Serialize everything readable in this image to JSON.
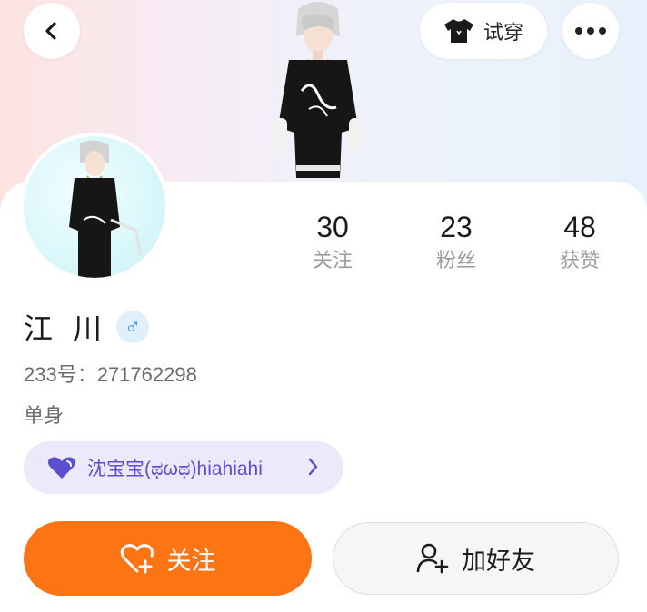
{
  "header": {
    "tryon_label": "试穿"
  },
  "stats": [
    {
      "value": "30",
      "label": "关注"
    },
    {
      "value": "23",
      "label": "粉丝"
    },
    {
      "value": "48",
      "label": "获赞"
    }
  ],
  "profile": {
    "name": "江川",
    "gender_symbol": "♂",
    "id_text": "233号：271762298",
    "relationship_status": "单身",
    "partner_label": "沈宝宝(ಥωಥ)hiahiahi"
  },
  "actions": {
    "follow_label": "关注",
    "add_friend_label": "加好友"
  },
  "colors": {
    "accent_orange": "#fd7414",
    "partner_purple": "#5a4fcf",
    "gender_blue": "#2e8fd6"
  },
  "icons": [
    "back-icon",
    "tshirt-icon",
    "more-icon",
    "heart-icon",
    "chevron-right-icon",
    "heart-plus-icon",
    "add-user-icon"
  ]
}
